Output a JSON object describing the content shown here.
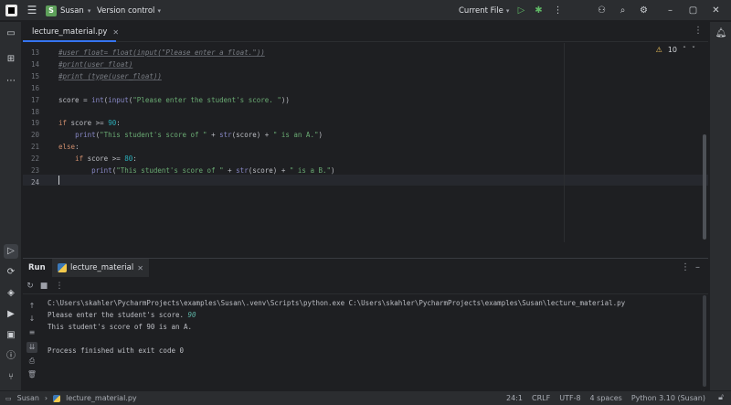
{
  "titlebar": {
    "project_initial": "S",
    "project_name": "Susan",
    "vcs_label": "Version control",
    "run_config": "Current File"
  },
  "editor": {
    "tab_label": "lecture_material.py",
    "inspections_count": "10",
    "line_numbers": [
      "13",
      "14",
      "15",
      "16",
      "17",
      "18",
      "19",
      "20",
      "21",
      "22",
      "23",
      "24"
    ],
    "lines": [
      [
        {
          "t": "#user_float= float(input(\"Please enter a float.\"))",
          "c": "cm"
        }
      ],
      [
        {
          "t": "#print(user_float)",
          "c": "cm"
        }
      ],
      [
        {
          "t": "#print (type(user_float))",
          "c": "cm"
        }
      ],
      [],
      [
        {
          "t": "score = ",
          "c": ""
        },
        {
          "t": "int",
          "c": "bi"
        },
        {
          "t": "(",
          "c": ""
        },
        {
          "t": "input",
          "c": "bi"
        },
        {
          "t": "(",
          "c": ""
        },
        {
          "t": "\"Please enter the student's score. \"",
          "c": "st"
        },
        {
          "t": "))",
          "c": ""
        }
      ],
      [],
      [
        {
          "t": "if",
          "c": "kw"
        },
        {
          "t": " score >= ",
          "c": ""
        },
        {
          "t": "90",
          "c": "nm"
        },
        {
          "t": ":",
          "c": ""
        }
      ],
      [
        {
          "t": "    ",
          "c": ""
        },
        {
          "t": "print",
          "c": "bi"
        },
        {
          "t": "(",
          "c": ""
        },
        {
          "t": "\"This student's score of \"",
          "c": "st"
        },
        {
          "t": " + ",
          "c": ""
        },
        {
          "t": "str",
          "c": "bi"
        },
        {
          "t": "(score) + ",
          "c": ""
        },
        {
          "t": "\" is an A.\"",
          "c": "st"
        },
        {
          "t": ")",
          "c": ""
        }
      ],
      [
        {
          "t": "else",
          "c": "kw"
        },
        {
          "t": ":",
          "c": ""
        }
      ],
      [
        {
          "t": "    ",
          "c": ""
        },
        {
          "t": "if",
          "c": "kw"
        },
        {
          "t": " score >= ",
          "c": ""
        },
        {
          "t": "80",
          "c": "nm"
        },
        {
          "t": ":",
          "c": ""
        }
      ],
      [
        {
          "t": "        ",
          "c": ""
        },
        {
          "t": "print",
          "c": "bi"
        },
        {
          "t": "(",
          "c": ""
        },
        {
          "t": "\"This student's score of \"",
          "c": "st"
        },
        {
          "t": " + ",
          "c": ""
        },
        {
          "t": "str",
          "c": "bi"
        },
        {
          "t": "(score) + ",
          "c": ""
        },
        {
          "t": "\" is a B.\"",
          "c": "st"
        },
        {
          "t": ")",
          "c": ""
        }
      ],
      []
    ]
  },
  "run": {
    "title": "Run",
    "tab_label": "lecture_material",
    "console": [
      "C:\\Users\\skahler\\PycharmProjects\\examples\\Susan\\.venv\\Scripts\\python.exe C:\\Users\\skahler\\PycharmProjects\\examples\\Susan\\lecture_material.py",
      "Please enter the student's score. ",
      "This student's score of 90 is an A.",
      "",
      "Process finished with exit code 0"
    ],
    "user_input": "90"
  },
  "status": {
    "project": "Susan",
    "file": "lecture_material.py",
    "position": "24:1",
    "line_sep": "CRLF",
    "encoding": "UTF-8",
    "indent": "4 spaces",
    "interpreter": "Python 3.10 (Susan)"
  }
}
